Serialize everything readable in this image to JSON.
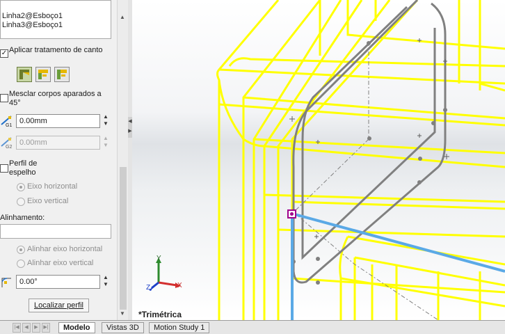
{
  "panel": {
    "selection_items": [
      "Linha2@Esboço1",
      "Linha3@Esboço1"
    ],
    "corner_treatment_label": "Aplicar tratamento de canto",
    "corner_treatment_checked": true,
    "merge_trimmed_label": "Mesclar corpos aparados a 45°",
    "merge_trimmed_checked": false,
    "gap1_label": "G1",
    "gap1_value": "0.00mm",
    "gap2_label": "G2",
    "gap2_value": "0.00mm",
    "mirror_profile_label": "Perfil de espelho",
    "mirror_profile_checked": false,
    "horizontal_axis_label": "Eixo horizontal",
    "vertical_axis_label": "Eixo vertical",
    "alignment_label": "Alinhamento:",
    "align_horizontal_label": "Alinhar eixo horizontal",
    "align_vertical_label": "Alinhar eixo vertical",
    "rotation_value": "0.00°",
    "locate_profile_label": "Localizar perfil"
  },
  "viewport": {
    "view_name": "*Trimétrica",
    "triad": {
      "x_label": "X",
      "y_label": "Y",
      "z_label": "Z"
    },
    "colors": {
      "highlight": "#ffff00",
      "sketch": "#808080",
      "selected_edge": "#5aa9e6",
      "point": "#a0008c"
    }
  },
  "tabs": [
    "Modelo",
    "Vistas 3D",
    "Motion Study 1"
  ],
  "active_tab": "Modelo"
}
